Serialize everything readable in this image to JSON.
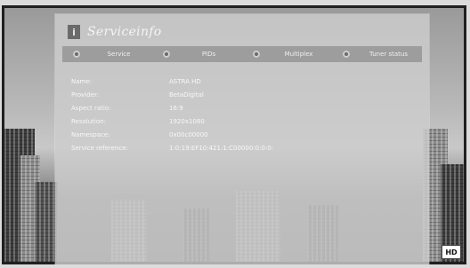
{
  "window": {
    "title": "Serviceinfo",
    "title_icon": "info-icon"
  },
  "tabs": [
    {
      "label": "Service"
    },
    {
      "label": "PIDs"
    },
    {
      "label": "Multiplex"
    },
    {
      "label": "Tuner status"
    }
  ],
  "info": [
    {
      "label": "Name:",
      "value": "ASTRA HD"
    },
    {
      "label": "Provider:",
      "value": "BetaDigital"
    },
    {
      "label": "Aspect ratio:",
      "value": "16:9"
    },
    {
      "label": "Resolution:",
      "value": "1920x1080"
    },
    {
      "label": "Namespace:",
      "value": "0x00c00000"
    },
    {
      "label": "Service reference:",
      "value": "1:0:19:EF10:421:1:C00000:0:0:0:"
    }
  ],
  "badge": {
    "label": "HD"
  },
  "colors": {
    "panel": "#cdcdcd",
    "tabbar": "#9d9d9d",
    "frame": "#202020"
  }
}
